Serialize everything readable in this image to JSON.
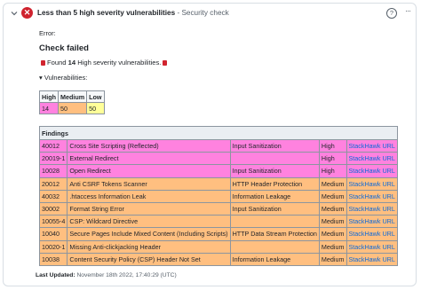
{
  "header": {
    "title": "Less than 5 high severity vulnerabilities",
    "separator": " - ",
    "subtitle": "Security check",
    "help_glyph": "?",
    "more_glyph": "···",
    "icons": [
      "chevron-down-icon",
      "error-icon",
      "help-icon",
      "more-icon"
    ]
  },
  "body": {
    "error_label": "Error:",
    "heading": "Check failed",
    "found_prefix": "Found",
    "found_count": "14",
    "found_suffix": "High severity vulnerabilities.",
    "vulnerabilities_summary": "▾ Vulnerabilities:"
  },
  "severity": {
    "headers": [
      "High",
      "Medium",
      "Low"
    ],
    "values": [
      "14",
      "50",
      "50"
    ],
    "colors": {
      "high": "#ff82df",
      "medium": "#ffbf80",
      "low": "#ffff99"
    }
  },
  "findings": {
    "title": "Findings",
    "rows": [
      {
        "id": "40012",
        "name": "Cross Site Scripting (Reflected)",
        "category": "Input Sanitization",
        "severity": "High",
        "link": "StackHawk URL"
      },
      {
        "id": "20019-1",
        "name": "External Redirect",
        "category": "",
        "severity": "High",
        "link": "StackHawk URL"
      },
      {
        "id": "10028",
        "name": "Open Redirect",
        "category": "Input Sanitization",
        "severity": "High",
        "link": "StackHawk URL"
      },
      {
        "id": "20012",
        "name": "Anti CSRF Tokens Scanner",
        "category": "HTTP Header Protection",
        "severity": "Medium",
        "link": "StackHawk URL"
      },
      {
        "id": "40032",
        "name": ".htaccess Information Leak",
        "category": "Information Leakage",
        "severity": "Medium",
        "link": "StackHawk URL"
      },
      {
        "id": "30002",
        "name": "Format String Error",
        "category": "Input Sanitization",
        "severity": "Medium",
        "link": "StackHawk URL"
      },
      {
        "id": "10055-4",
        "name": "CSP: Wildcard Directive",
        "category": "",
        "severity": "Medium",
        "link": "StackHawk URL"
      },
      {
        "id": "10040",
        "name": "Secure Pages Include Mixed Content (Including Scripts)",
        "category": "HTTP Data Stream Protection",
        "severity": "Medium",
        "link": "StackHawk URL"
      },
      {
        "id": "10020-1",
        "name": "Missing Anti-clickjacking Header",
        "category": "",
        "severity": "Medium",
        "link": "StackHawk URL"
      },
      {
        "id": "10038",
        "name": "Content Security Policy (CSP) Header Not Set",
        "category": "Information Leakage",
        "severity": "Medium",
        "link": "StackHawk URL"
      }
    ]
  },
  "footer": {
    "label": "Last Updated:",
    "value": "November 18th 2022, 17:40:29 (UTC)"
  }
}
